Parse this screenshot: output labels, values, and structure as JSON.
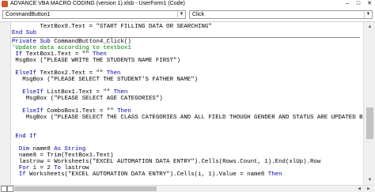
{
  "window": {
    "title": "ADVANCE VBA MACRO CODING (version 1).xlsb - UserForm1 (Code)"
  },
  "toolbar": {
    "object_combo": {
      "value": "CommandButton1"
    },
    "procedure_combo": {
      "value": "Click"
    }
  },
  "code": {
    "lines": [
      {
        "sep": false,
        "tokens": [
          {
            "t": "        TextBox9.Text = \"START FILLING DATA OR SEARCHING\"",
            "c": "tx"
          }
        ]
      },
      {
        "sep": false,
        "tokens": [
          {
            "t": "End Sub",
            "c": "kw"
          }
        ]
      },
      {
        "sep": true,
        "tokens": []
      },
      {
        "sep": false,
        "tokens": [
          {
            "t": "Private Sub",
            "c": "kw"
          },
          {
            "t": " CommandButton4_Click()",
            "c": "tx"
          }
        ]
      },
      {
        "sep": false,
        "tokens": [
          {
            "t": "'Update data according to textbox1",
            "c": "cm"
          }
        ]
      },
      {
        "sep": false,
        "tokens": [
          {
            "t": " If",
            "c": "kw"
          },
          {
            "t": " TextBox1.Text = \"\" ",
            "c": "tx"
          },
          {
            "t": "Then",
            "c": "kw"
          }
        ]
      },
      {
        "sep": false,
        "tokens": [
          {
            "t": " MsgBox (\"PLEASE WRITE THE STUDENTS NAME FIRST\")",
            "c": "tx"
          }
        ]
      },
      {
        "sep": false,
        "tokens": [
          {
            "t": "",
            "c": "tx"
          }
        ]
      },
      {
        "sep": false,
        "tokens": [
          {
            "t": " ElseIf",
            "c": "kw"
          },
          {
            "t": " TextBox2.Text = \"\" ",
            "c": "tx"
          },
          {
            "t": "Then",
            "c": "kw"
          }
        ]
      },
      {
        "sep": false,
        "tokens": [
          {
            "t": "   MsgBox (\"PLEASE SELECT THE STUDENT'S FATHER NAME\")",
            "c": "tx"
          }
        ]
      },
      {
        "sep": false,
        "tokens": [
          {
            "t": "",
            "c": "tx"
          }
        ]
      },
      {
        "sep": false,
        "tokens": [
          {
            "t": "   ElseIf",
            "c": "kw"
          },
          {
            "t": " ListBox1.Text = \"\" ",
            "c": "tx"
          },
          {
            "t": "Then",
            "c": "kw"
          }
        ]
      },
      {
        "sep": false,
        "tokens": [
          {
            "t": "    MsgBox (\"PLEASE SELECT AGE CATEGORIES\")",
            "c": "tx"
          }
        ]
      },
      {
        "sep": false,
        "tokens": [
          {
            "t": "",
            "c": "tx"
          }
        ]
      },
      {
        "sep": false,
        "tokens": [
          {
            "t": "   ElseIf",
            "c": "kw"
          },
          {
            "t": " ComboBox1.Text = \"\" ",
            "c": "tx"
          },
          {
            "t": "Then",
            "c": "kw"
          }
        ]
      },
      {
        "sep": false,
        "tokens": [
          {
            "t": "    MsgBox (\"PLEASE SELECT THE CLASS CATEGORIES AND ALL FIELD THOUGH GENDER AND STATUS ARE UPDATED BEFOREHAND\")",
            "c": "tx"
          }
        ]
      },
      {
        "sep": false,
        "tokens": [
          {
            "t": "",
            "c": "tx"
          }
        ]
      },
      {
        "sep": false,
        "tokens": [
          {
            "t": "",
            "c": "tx"
          }
        ]
      },
      {
        "sep": false,
        "tokens": [
          {
            "t": " End If",
            "c": "kw"
          }
        ]
      },
      {
        "sep": false,
        "tokens": [
          {
            "t": "",
            "c": "tx"
          }
        ]
      },
      {
        "sep": false,
        "tokens": [
          {
            "t": "  Dim",
            "c": "kw"
          },
          {
            "t": " name8 ",
            "c": "tx"
          },
          {
            "t": "As String",
            "c": "kw"
          }
        ]
      },
      {
        "sep": false,
        "tokens": [
          {
            "t": "  name8 = Trim(TextBox1.Text)",
            "c": "tx"
          }
        ]
      },
      {
        "sep": false,
        "tokens": [
          {
            "t": "  lastrow = Worksheets(\"EXCEL AUTOMATION DATA ENTRY\").Cells(Rows.Count, 1).End(xlUp).Row",
            "c": "tx"
          }
        ]
      },
      {
        "sep": false,
        "tokens": [
          {
            "t": "  For",
            "c": "kw"
          },
          {
            "t": " i = 2 ",
            "c": "tx"
          },
          {
            "t": "To",
            "c": "kw"
          },
          {
            "t": " lastrow",
            "c": "tx"
          }
        ]
      },
      {
        "sep": false,
        "tokens": [
          {
            "t": "  If",
            "c": "kw"
          },
          {
            "t": " Worksheets(\"EXCEL AUTOMATION DATA ENTRY\").Cells(i, 1).Value = name8 ",
            "c": "tx"
          },
          {
            "t": "Then",
            "c": "kw"
          }
        ]
      }
    ]
  },
  "icons": {
    "app": "vba-icon",
    "minimize": "minimize-icon",
    "maximize": "maximize-icon",
    "close": "close-icon",
    "dropdown": "chevron-down-icon"
  },
  "colors": {
    "keyword": "#0000a0",
    "comment": "#008000",
    "text": "#000000"
  }
}
